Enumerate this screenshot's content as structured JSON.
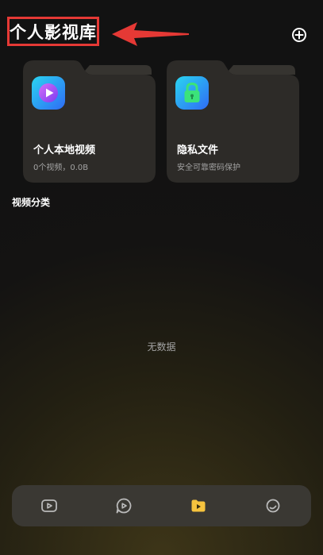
{
  "header": {
    "title": "个人影视库"
  },
  "folders": [
    {
      "name": "个人本地视频",
      "subtitle": "0个视频，0.0B",
      "icon": "play-video-icon"
    },
    {
      "name": "隐私文件",
      "subtitle": "安全可靠密码保护",
      "icon": "lock-icon"
    }
  ],
  "sections": {
    "video_category_title": "视频分类",
    "empty_text": "无数据"
  },
  "bottom_nav": {
    "items": [
      {
        "icon": "video-tab-icon",
        "active": false
      },
      {
        "icon": "play-chat-tab-icon",
        "active": false
      },
      {
        "icon": "library-tab-icon",
        "active": true
      },
      {
        "icon": "profile-tab-icon",
        "active": false
      }
    ]
  },
  "colors": {
    "accent": "#f6c33e",
    "annotation": "#e53935",
    "card": "#2d2b28",
    "nav_bar": "#3a3833"
  }
}
